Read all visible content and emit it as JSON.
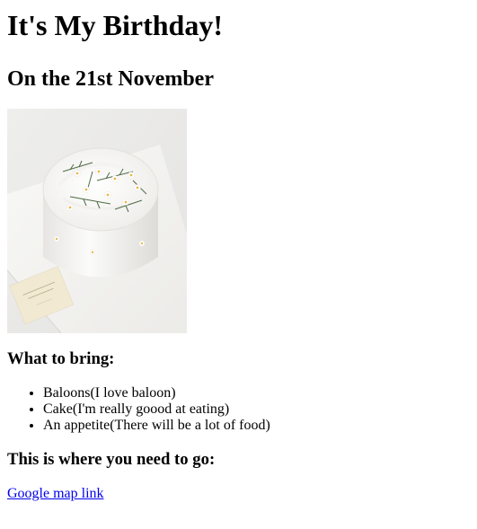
{
  "header": {
    "title": "It's My Birthday!",
    "subtitle": "On the 21st November"
  },
  "image": {
    "subject": "cake-photo",
    "card_text": "Edelweiss Butter"
  },
  "bring": {
    "heading": "What to bring:",
    "items": [
      "Baloons(I love baloon)",
      "Cake(I'm really goood at eating)",
      "An appetite(There will be a lot of food)"
    ]
  },
  "directions": {
    "heading": "This is where you need to go:",
    "link_text": "Google map link"
  },
  "colors": {
    "link": "#0000ee",
    "text": "#000000",
    "background": "#ffffff"
  }
}
